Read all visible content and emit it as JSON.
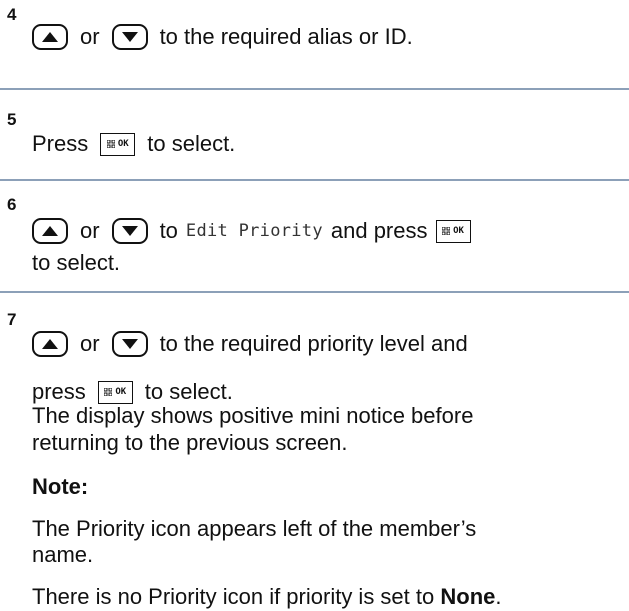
{
  "steps": [
    {
      "number": "4",
      "or": "or",
      "text": "to the required alias or ID."
    },
    {
      "number": "5",
      "press": "Press",
      "text": "to select."
    },
    {
      "number": "6",
      "or": "or",
      "to": "to",
      "menu_item": "Edit Priority",
      "and_press": "and press",
      "line2": "to select."
    },
    {
      "number": "7",
      "or": "or",
      "text": "to the required priority level and",
      "press": "press",
      "to_select": "to select.",
      "result_line1": "The display shows positive mini notice before",
      "result_line2": "returning to the previous screen.",
      "note_label": "Note:",
      "note_line1": "The Priority icon appears left of the member’s",
      "note_line2": "name.",
      "note_line3_pre": "There is no Priority icon if priority is set to",
      "note_line3_bold": "None",
      "note_line3_post": "."
    }
  ],
  "keys": {
    "ok_label": "OK",
    "up_icon": "arrow-up-key-icon",
    "down_icon": "arrow-down-key-icon",
    "menu_icon": "menu-grid-icon"
  },
  "colors": {
    "rule": "#8ca0b8"
  }
}
